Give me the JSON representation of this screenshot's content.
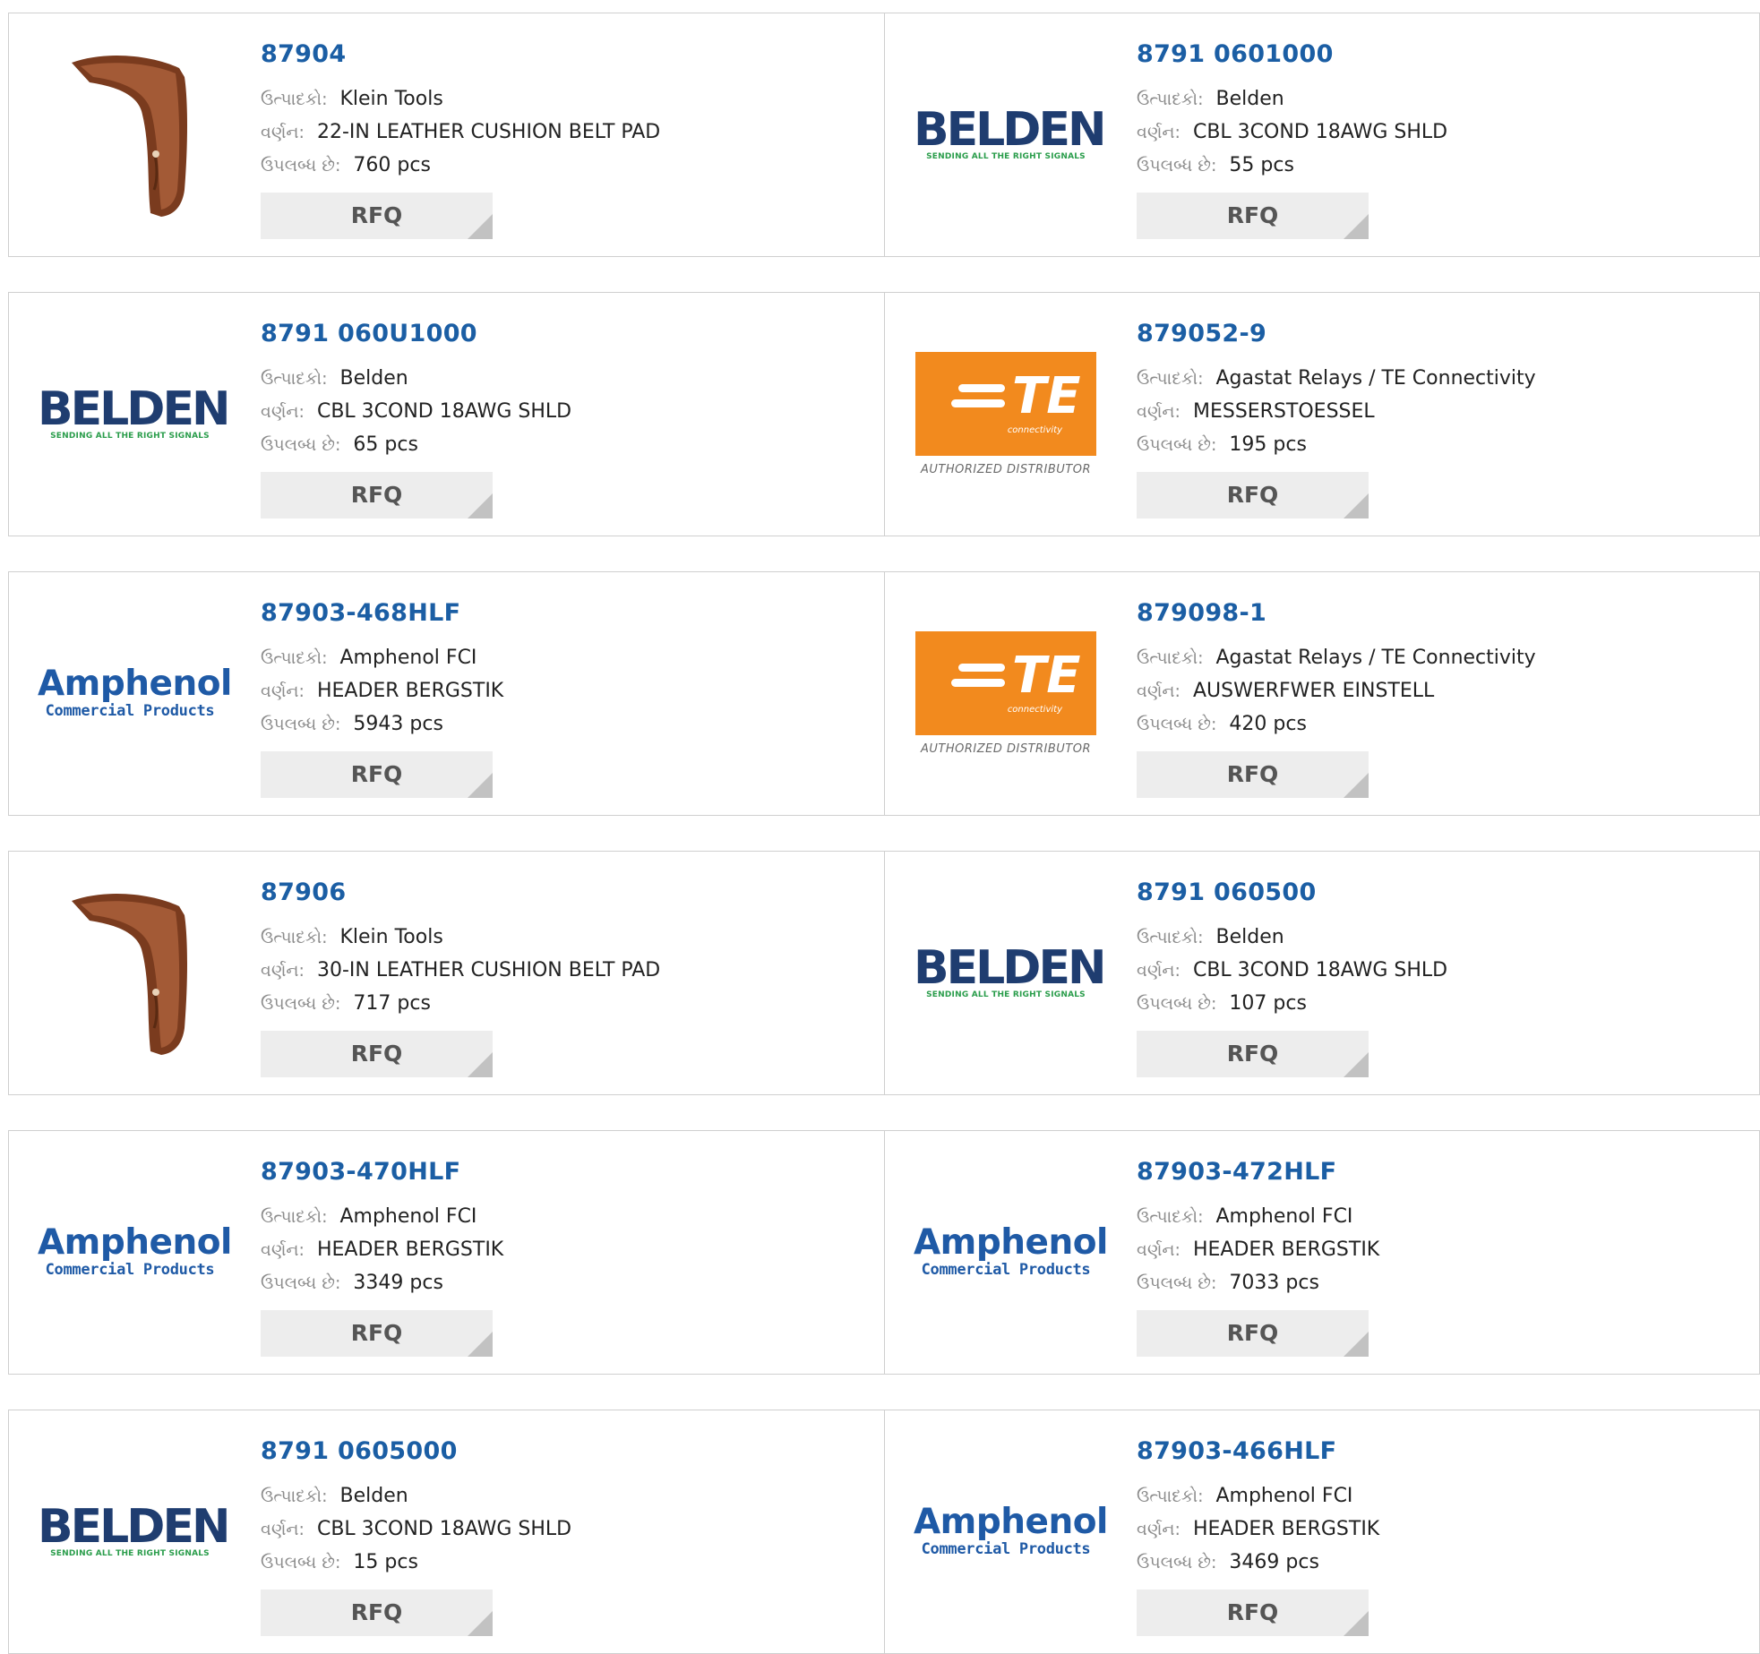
{
  "labels": {
    "manufacturer": "ઉત્પાદકો:",
    "description": "વર્ણન:",
    "available": "ઉપલબ્ધ છે:",
    "rfq": "RFQ"
  },
  "colors": {
    "part_link": "#1b5ea4",
    "rfq_bg": "#ededed",
    "border": "#cfcfcf"
  },
  "products": [
    {
      "part": "87904",
      "manufacturer": "Klein Tools",
      "description": "22-IN LEATHER CUSHION BELT PAD",
      "stock": "760 pcs",
      "logo": "belt-pad-image"
    },
    {
      "part": "8791 0601000",
      "manufacturer": "Belden",
      "description": "CBL 3COND 18AWG SHLD",
      "stock": "55 pcs",
      "logo": "belden-logo"
    },
    {
      "part": "8791 060U1000",
      "manufacturer": "Belden",
      "description": "CBL 3COND 18AWG SHLD",
      "stock": "65 pcs",
      "logo": "belden-logo"
    },
    {
      "part": "879052-9",
      "manufacturer": "Agastat Relays / TE Connectivity",
      "description": "MESSERSTOESSEL",
      "stock": "195 pcs",
      "logo": "te-logo"
    },
    {
      "part": "87903-468HLF",
      "manufacturer": "Amphenol FCI",
      "description": "HEADER BERGSTIK",
      "stock": "5943 pcs",
      "logo": "amphenol-logo"
    },
    {
      "part": "879098-1",
      "manufacturer": "Agastat Relays / TE Connectivity",
      "description": "AUSWERFWER EINSTELL",
      "stock": "420 pcs",
      "logo": "te-logo"
    },
    {
      "part": "87906",
      "manufacturer": "Klein Tools",
      "description": "30-IN LEATHER CUSHION BELT PAD",
      "stock": "717 pcs",
      "logo": "belt-pad-image"
    },
    {
      "part": "8791 060500",
      "manufacturer": "Belden",
      "description": "CBL 3COND 18AWG SHLD",
      "stock": "107 pcs",
      "logo": "belden-logo"
    },
    {
      "part": "87903-470HLF",
      "manufacturer": "Amphenol FCI",
      "description": "HEADER BERGSTIK",
      "stock": "3349 pcs",
      "logo": "amphenol-logo"
    },
    {
      "part": "87903-472HLF",
      "manufacturer": "Amphenol FCI",
      "description": "HEADER BERGSTIK",
      "stock": "7033 pcs",
      "logo": "amphenol-logo"
    },
    {
      "part": "8791 0605000",
      "manufacturer": "Belden",
      "description": "CBL 3COND 18AWG SHLD",
      "stock": "15 pcs",
      "logo": "belden-logo"
    },
    {
      "part": "87903-466HLF",
      "manufacturer": "Amphenol FCI",
      "description": "HEADER BERGSTIK",
      "stock": "3469 pcs",
      "logo": "amphenol-logo"
    }
  ],
  "logos": {
    "belden": {
      "word": "BELDEN",
      "tagline": "SENDING ALL THE RIGHT SIGNALS"
    },
    "amphenol": {
      "word": "Amphenol",
      "sub": "Commercial Products"
    },
    "te": {
      "word": "TE",
      "sub": "connectivity",
      "badge": "AUTHORIZED DISTRIBUTOR"
    }
  }
}
